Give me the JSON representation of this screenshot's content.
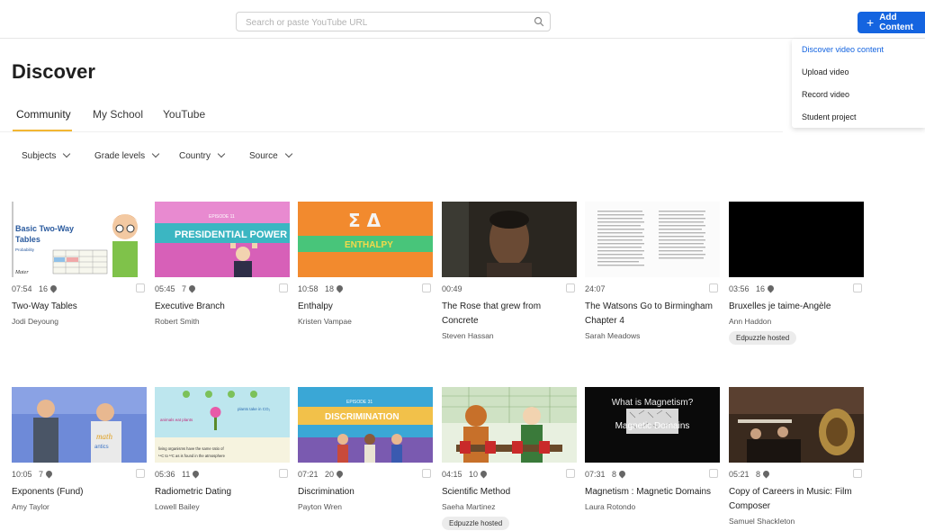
{
  "search": {
    "placeholder": "Search or paste YouTube URL",
    "icon": "search-icon"
  },
  "add_button": {
    "label": "Add Content"
  },
  "menu": {
    "items": [
      "Discover video content",
      "Upload video",
      "Record video",
      "Student project"
    ],
    "active_color": "#1464e0"
  },
  "page": {
    "title": "Discover",
    "tabs": [
      "Community",
      "My School",
      "YouTube"
    ],
    "active_tab": "Community"
  },
  "filters": [
    "Subjects",
    "Grade levels",
    "Country",
    "Source"
  ],
  "videos": [
    {
      "duration": "07:54",
      "questions": "16",
      "title": "Two-Way Tables",
      "author": "Jodi Deyoung",
      "badge": "",
      "thumb_title": "Basic Two-Way Tables",
      "thumb_sub": "Probability",
      "thumb_logo": "Mathantics"
    },
    {
      "duration": "05:45",
      "questions": "7",
      "title": "Executive Branch",
      "author": "Robert Smith",
      "badge": "",
      "thumb_episode": "EPISODE 11",
      "thumb_title": "PRESIDENTIAL POWER"
    },
    {
      "duration": "10:58",
      "questions": "18",
      "title": "Enthalpy",
      "author": "Kristen Vampae",
      "badge": "",
      "thumb_symbols": "Σ Δ",
      "thumb_title": "ENTHALPY"
    },
    {
      "duration": "00:49",
      "questions": "",
      "title": "The Rose that grew from Concrete",
      "author": "Steven Hassan",
      "badge": ""
    },
    {
      "duration": "24:07",
      "questions": "",
      "title": "The Watsons Go to Birmingham Chapter 4",
      "author": "Sarah Meadows",
      "badge": ""
    },
    {
      "duration": "03:56",
      "questions": "16",
      "title": "Bruxelles je taime-Angèle",
      "author": "Ann Haddon",
      "badge": "Edpuzzle hosted"
    },
    {
      "duration": "10:05",
      "questions": "7",
      "title": "Exponents (Fund)",
      "author": "Amy Taylor",
      "badge": "",
      "thumb_title": "Math Antics"
    },
    {
      "duration": "05:36",
      "questions": "11",
      "title": "Radiometric Dating",
      "author": "Lowell Bailey",
      "badge": "",
      "thumb_text1": "animals eat plants",
      "thumb_text2": "plants take in CO₂",
      "thumb_caption": "living organisms have the same ratio of ¹⁴C to ¹²C as is found in the atmosphere"
    },
    {
      "duration": "07:21",
      "questions": "20",
      "title": "Discrimination",
      "author": "Payton Wren",
      "badge": "",
      "thumb_episode": "EPISODE 31",
      "thumb_title": "DISCRIMINATION"
    },
    {
      "duration": "04:15",
      "questions": "10",
      "title": "Scientific Method",
      "author": "Saeha Martinez",
      "badge": "Edpuzzle hosted"
    },
    {
      "duration": "07:31",
      "questions": "8",
      "title": "Magnetism : Magnetic Domains",
      "author": "Laura Rotondo",
      "badge": "",
      "thumb_line1": "What is Magnetism?",
      "thumb_line2": "Magnetic Domains"
    },
    {
      "duration": "05:21",
      "questions": "8",
      "title": "Copy of Careers in Music: Film Composer",
      "author": "Samuel Shackleton",
      "badge": ""
    }
  ]
}
